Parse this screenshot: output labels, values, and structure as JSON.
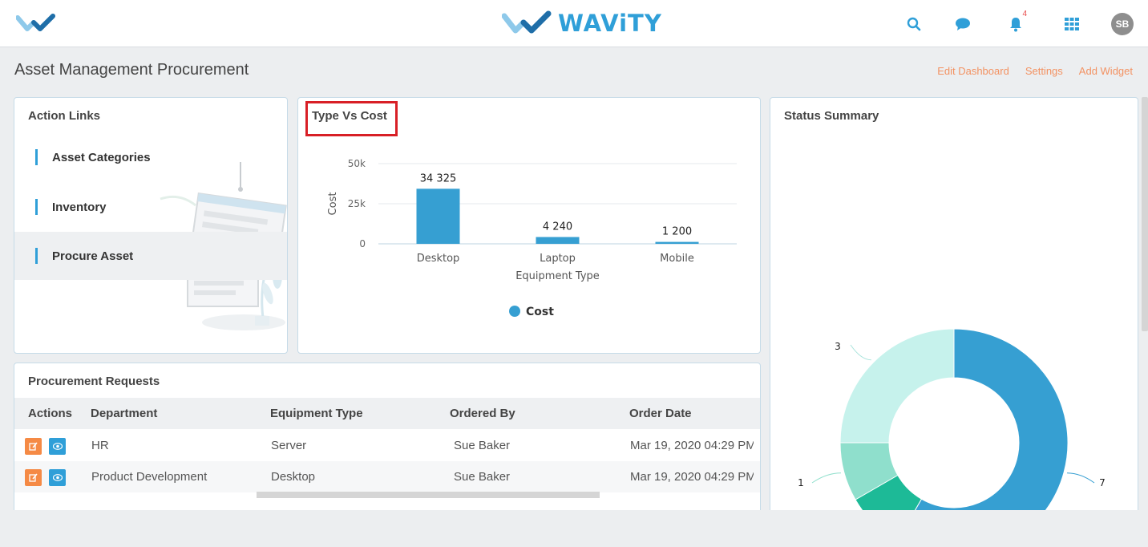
{
  "brand": {
    "name": "WAViTY",
    "logo_icon": "wavity-check-logo",
    "accent": "#2f9fd8"
  },
  "topbar": {
    "icons": [
      "search-icon",
      "chat-icon",
      "bell-icon",
      "apps-grid-icon"
    ],
    "notification_count": "4",
    "avatar_initials": "SB"
  },
  "page": {
    "title": "Asset Management Procurement",
    "links": {
      "edit": "Edit Dashboard",
      "settings": "Settings",
      "add_widget": "Add Widget"
    }
  },
  "action_links": {
    "title": "Action Links",
    "items": [
      {
        "label": "Asset Categories"
      },
      {
        "label": "Inventory"
      },
      {
        "label": "Procure Asset"
      }
    ]
  },
  "type_vs_cost": {
    "title": "Type Vs Cost",
    "legend": "Cost"
  },
  "chart_data": [
    {
      "type": "bar",
      "title": "Type Vs Cost",
      "categories": [
        "Desktop",
        "Laptop",
        "Mobile"
      ],
      "series": [
        {
          "name": "Cost",
          "values": [
            34325,
            4240,
            1200
          ],
          "color": "#369fd2"
        }
      ],
      "data_labels": [
        "34 325",
        "4 240",
        "1 200"
      ],
      "xlabel": "Equipment Type",
      "ylabel": "Cost",
      "yticks": [
        "0",
        "25k",
        "50k"
      ],
      "ylim": [
        0,
        50000
      ],
      "grid": true,
      "legend": "bottom"
    },
    {
      "type": "pie",
      "title": "Status Summary",
      "slices": [
        {
          "label": "7",
          "value": 7,
          "color": "#369fd2"
        },
        {
          "value": 1,
          "color": "#1dba97"
        },
        {
          "label": "1",
          "value": 1,
          "color": "#8fdfcc"
        },
        {
          "label": "3",
          "value": 3,
          "color": "#c6f2ec"
        }
      ],
      "donut": true
    }
  ],
  "status_summary": {
    "title": "Status Summary",
    "labels": {
      "a": "3",
      "b": "1",
      "c": "7"
    }
  },
  "procurement": {
    "title": "Procurement Requests",
    "columns": [
      "Actions",
      "Department",
      "Equipment Type",
      "Ordered By",
      "Order Date"
    ],
    "rows": [
      {
        "department": "HR",
        "equipment": "Server",
        "ordered_by": "Sue Baker",
        "date": "Mar 19, 2020 04:29 PM"
      },
      {
        "department": "Product Development",
        "equipment": "Desktop",
        "ordered_by": "Sue Baker",
        "date": "Mar 19, 2020 04:29 PM"
      }
    ]
  }
}
